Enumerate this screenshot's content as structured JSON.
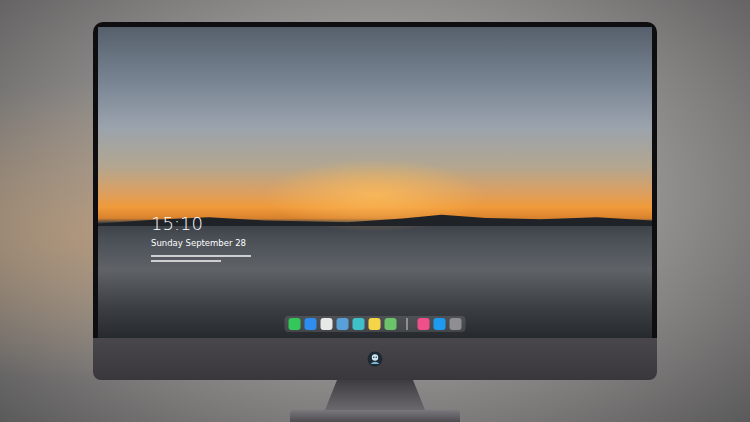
{
  "lock_screen": {
    "time": "15:10",
    "date": "Sunday September 28"
  },
  "dock": {
    "items": [
      {
        "kind": "app",
        "color": "#34c759"
      },
      {
        "kind": "app",
        "color": "#2f8cf0"
      },
      {
        "kind": "app",
        "color": "#e8e8e8"
      },
      {
        "kind": "app",
        "color": "#5aa0d8"
      },
      {
        "kind": "app",
        "color": "#3fc1c9"
      },
      {
        "kind": "app",
        "color": "#f5d547"
      },
      {
        "kind": "app",
        "color": "#6cc36a"
      },
      {
        "kind": "separator",
        "color": "#cfcfcf"
      },
      {
        "kind": "app",
        "color": "#f0508a"
      },
      {
        "kind": "app",
        "color": "#1e9bf0"
      },
      {
        "kind": "app",
        "color": "#8e8e93"
      }
    ]
  }
}
